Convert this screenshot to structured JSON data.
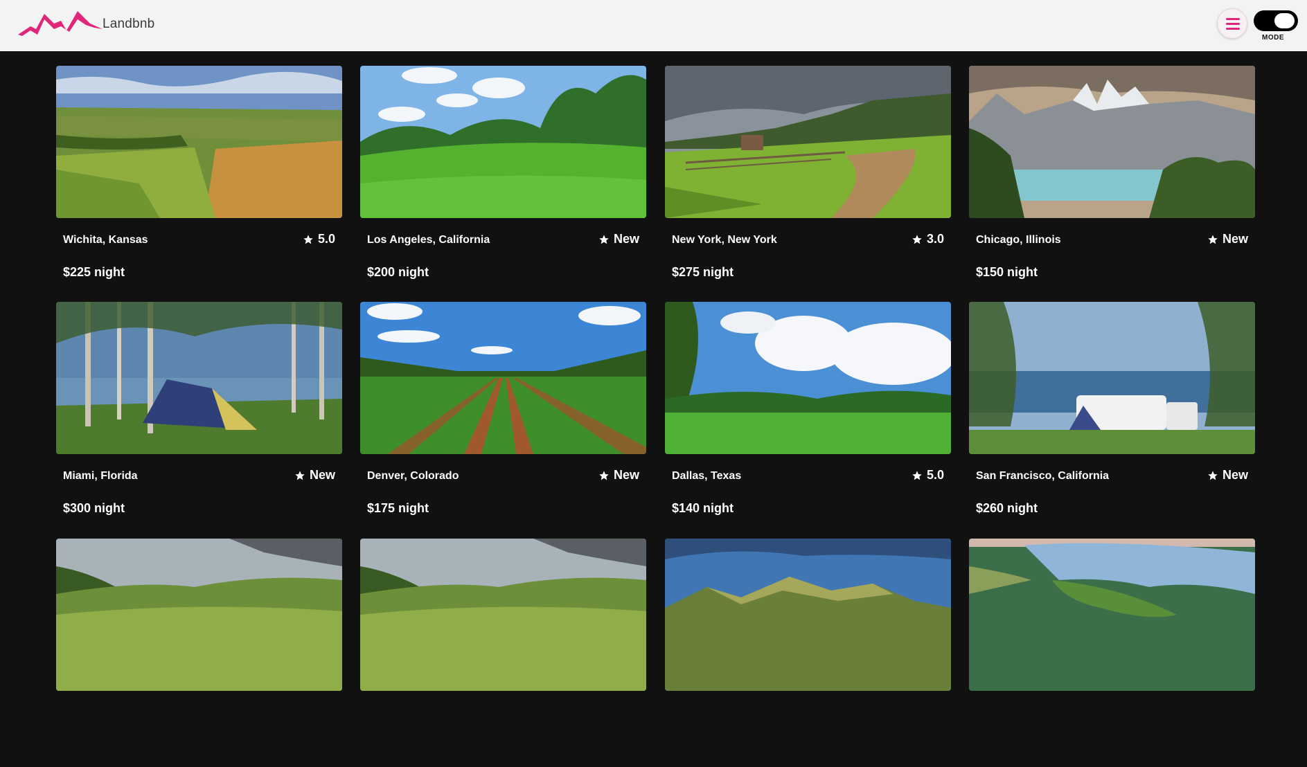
{
  "header": {
    "brand": "Landbnb",
    "mode_label": "MODE",
    "accent_color": "#e0267b"
  },
  "listings": [
    {
      "location": "Wichita, Kansas",
      "rating": "5.0",
      "price": "$225 night",
      "scene": "farmland-aerial"
    },
    {
      "location": "Los Angeles, California",
      "rating": "New",
      "price": "$200 night",
      "scene": "green-meadow"
    },
    {
      "location": "New York, New York",
      "rating": "3.0",
      "price": "$275 night",
      "scene": "country-road-barn"
    },
    {
      "location": "Chicago, Illinois",
      "rating": "New",
      "price": "$150 night",
      "scene": "mountain-lake"
    },
    {
      "location": "Miami, Florida",
      "rating": "New",
      "price": "$300 night",
      "scene": "tent-by-lake"
    },
    {
      "location": "Denver, Colorado",
      "rating": "New",
      "price": "$175 night",
      "scene": "crop-rows"
    },
    {
      "location": "Dallas, Texas",
      "rating": "5.0",
      "price": "$140 night",
      "scene": "grass-field-clouds"
    },
    {
      "location": "San Francisco, California",
      "rating": "New",
      "price": "$260 night",
      "scene": "rv-by-lake"
    },
    {
      "scene": "rolling-hills"
    },
    {
      "scene": "rolling-hills"
    },
    {
      "scene": "green-peaks"
    },
    {
      "scene": "lake-aerial"
    }
  ]
}
